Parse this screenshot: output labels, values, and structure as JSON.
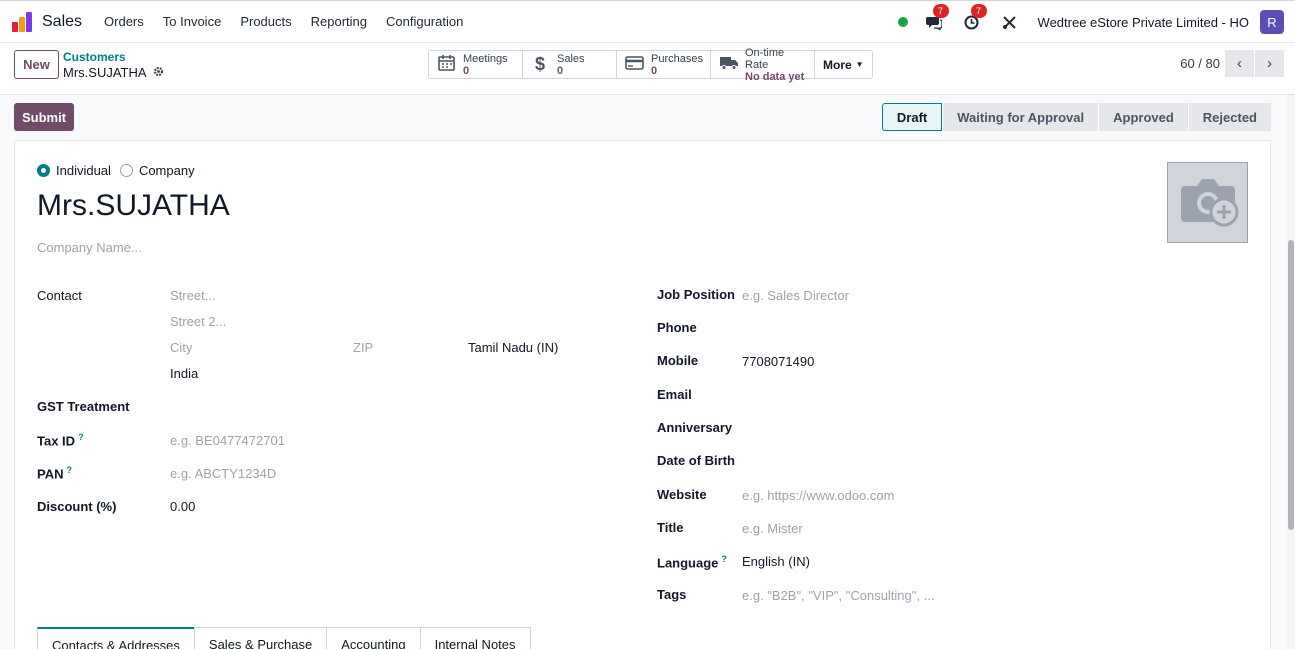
{
  "nav": {
    "app_title": "Sales",
    "menu": [
      "Orders",
      "To Invoice",
      "Products",
      "Reporting",
      "Configuration"
    ],
    "chat_badge": "7",
    "activity_badge": "7",
    "company": "Wedtree eStore Private Limited - HO",
    "avatar_letter": "R"
  },
  "control": {
    "new_label": "New",
    "breadcrumb": "Customers",
    "record_name": "Mrs.SUJATHA",
    "smart_buttons": [
      {
        "label": "Meetings",
        "value": "0",
        "icon": "calendar-icon"
      },
      {
        "label": "Sales",
        "value": "0",
        "icon": "dollar-icon"
      },
      {
        "label": "Purchases",
        "value": "0",
        "icon": "credit-card-icon"
      },
      {
        "label": "On-time Rate",
        "value": "No data yet",
        "icon": "truck-icon"
      }
    ],
    "more_label": "More",
    "pager": "60 / 80"
  },
  "actions": {
    "submit_label": "Submit",
    "stages": [
      "Draft",
      "Waiting for Approval",
      "Approved",
      "Rejected"
    ]
  },
  "form": {
    "type_individual": "Individual",
    "type_company": "Company",
    "name": "Mrs.SUJATHA",
    "company_placeholder": "Company Name...",
    "contact_label": "Contact",
    "street_ph": "Street...",
    "street2_ph": "Street 2...",
    "city_ph": "City",
    "zip_ph": "ZIP",
    "state": "Tamil Nadu (IN)",
    "country": "India",
    "gst_label": "GST Treatment",
    "taxid_label": "Tax ID",
    "taxid_ph": "e.g. BE0477472701",
    "pan_label": "PAN",
    "pan_ph": "e.g. ABCTY1234D",
    "discount_label": "Discount (%)",
    "discount_value": "0.00",
    "job_label": "Job Position",
    "job_ph": "e.g. Sales Director",
    "phone_label": "Phone",
    "mobile_label": "Mobile",
    "mobile_value": "7708071490",
    "email_label": "Email",
    "anniversary_label": "Anniversary",
    "dob_label": "Date of Birth",
    "website_label": "Website",
    "website_ph": "e.g. https://www.odoo.com",
    "title_label": "Title",
    "title_ph": "e.g. Mister",
    "language_label": "Language",
    "language_value": "English (IN)",
    "tags_label": "Tags",
    "tags_ph": "e.g. \"B2B\", \"VIP\", \"Consulting\", ...",
    "help_mark": "?"
  },
  "tabs": [
    "Contacts & Addresses",
    "Sales & Purchase",
    "Accounting",
    "Internal Notes"
  ]
}
